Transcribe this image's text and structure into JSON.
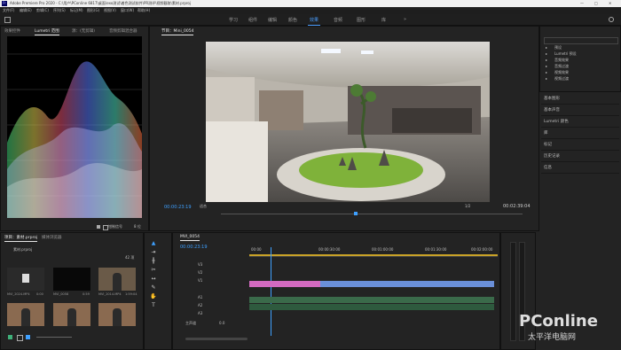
{
  "titlebar": {
    "title": "Adobe Premiere Pro 2020 - C:\\用户\\PConline 6817\\桌面\\exo测试\\着色测试软件\\PR测评\\视频截取\\素材.prproj",
    "minimize": "—",
    "maximize": "□",
    "close": "✕"
  },
  "menubar": {
    "items": [
      "文件(F)",
      "编辑(E)",
      "剪辑(C)",
      "序列(S)",
      "标记(M)",
      "图形(G)",
      "视图(V)",
      "窗口(W)",
      "帮助(H)"
    ]
  },
  "workspaces": {
    "items": [
      "学习",
      "组件",
      "编辑",
      "颜色",
      "效果",
      "音频",
      "图形",
      "库"
    ],
    "active": "效果"
  },
  "source_panel": {
    "tabs": [
      "效果控件",
      "Lumetri 范围",
      "源：(无剪辑)",
      "音频剪辑混合器"
    ],
    "active_tab": "Lumetri 范围",
    "footer_checkbox": "钳制信号",
    "footer_label": "8 位"
  },
  "program_monitor": {
    "tab": "节目：Mini_0054",
    "timecode_left": "00:00:23:19",
    "fit": "适合",
    "quality": "1/2",
    "timecode_right": "00:02:39:04"
  },
  "project_panel": {
    "tabs": [
      "项目：素材.prproj",
      "媒体浏览器"
    ],
    "filename": "素材.prproj",
    "count": "42 项",
    "items": [
      {
        "name": "MVI_2024.MP4",
        "duration": "0:00"
      },
      {
        "name": "MVI_0058",
        "duration": "0:59"
      },
      {
        "name": "MVI_2014.MP4",
        "duration": "1:59:04"
      },
      {
        "name": "",
        "duration": ""
      },
      {
        "name": "",
        "duration": ""
      },
      {
        "name": "",
        "duration": ""
      }
    ]
  },
  "timeline": {
    "tab": "MVI_0054",
    "timecode": "00:00:23:19",
    "ruler": [
      "00:00",
      "00:00:30:00",
      "00:01:00:00",
      "00:01:30:00",
      "00:02:00:00"
    ],
    "tracks": [
      "V3",
      "V2",
      "V1",
      "A1",
      "A2",
      "A3",
      "主声道"
    ],
    "master_value": "0.0"
  },
  "right_panel": {
    "tree": [
      "预设",
      "Lumetri 预设",
      "音频效果",
      "音频过渡",
      "视频效果",
      "视频过渡"
    ],
    "sections": [
      "基本图形",
      "基本声音",
      "Lumetri 颜色",
      "库",
      "标记",
      "历史记录",
      "信息"
    ]
  },
  "watermark": {
    "brand": "PConline",
    "sub": "太平洋电脑网"
  },
  "colors": {
    "accent": "#3ea0ff",
    "track_video": "#9f8cf0",
    "track_audio": "#3fb07a",
    "clip_pink": "#d46ac0",
    "clip_blue": "#6a8fd8"
  }
}
